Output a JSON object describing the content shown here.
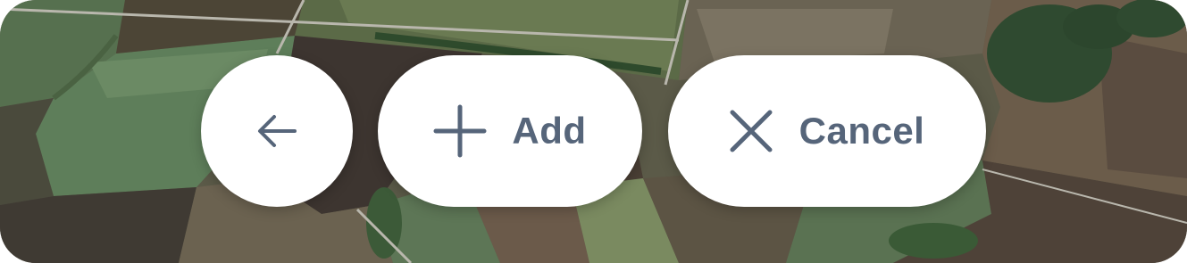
{
  "toolbar": {
    "back": {
      "icon": "arrow-left-icon"
    },
    "add": {
      "icon": "plus-icon",
      "label": "Add"
    },
    "cancel": {
      "icon": "close-icon",
      "label": "Cancel"
    }
  },
  "colors": {
    "button_background": "#ffffff",
    "button_foreground": "#56657a"
  },
  "background": {
    "type": "satellite-map",
    "description_icon": "satellite-farmland-map"
  }
}
